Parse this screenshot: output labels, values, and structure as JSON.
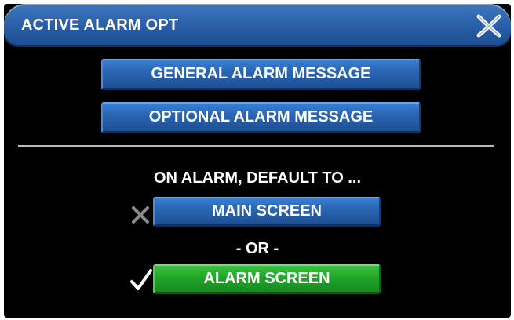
{
  "dialog": {
    "title": "ACTIVE ALARM OPT",
    "close_icon": "close-x-icon"
  },
  "message_buttons": {
    "general": "GENERAL ALARM MESSAGE",
    "optional": "OPTIONAL ALARM MESSAGE"
  },
  "default_section": {
    "heading": "ON ALARM, DEFAULT TO ...",
    "or_label": "- OR -",
    "options": [
      {
        "label": "MAIN SCREEN",
        "selected": false,
        "indicator_icon": "cross-icon"
      },
      {
        "label": "ALARM SCREEN",
        "selected": true,
        "indicator_icon": "checkmark-icon"
      }
    ]
  },
  "colors": {
    "title_bar": "#2b62aa",
    "button_blue": "#2a66b5",
    "button_green": "#22a52a",
    "background": "#000000",
    "divider": "#b8b8b8"
  }
}
